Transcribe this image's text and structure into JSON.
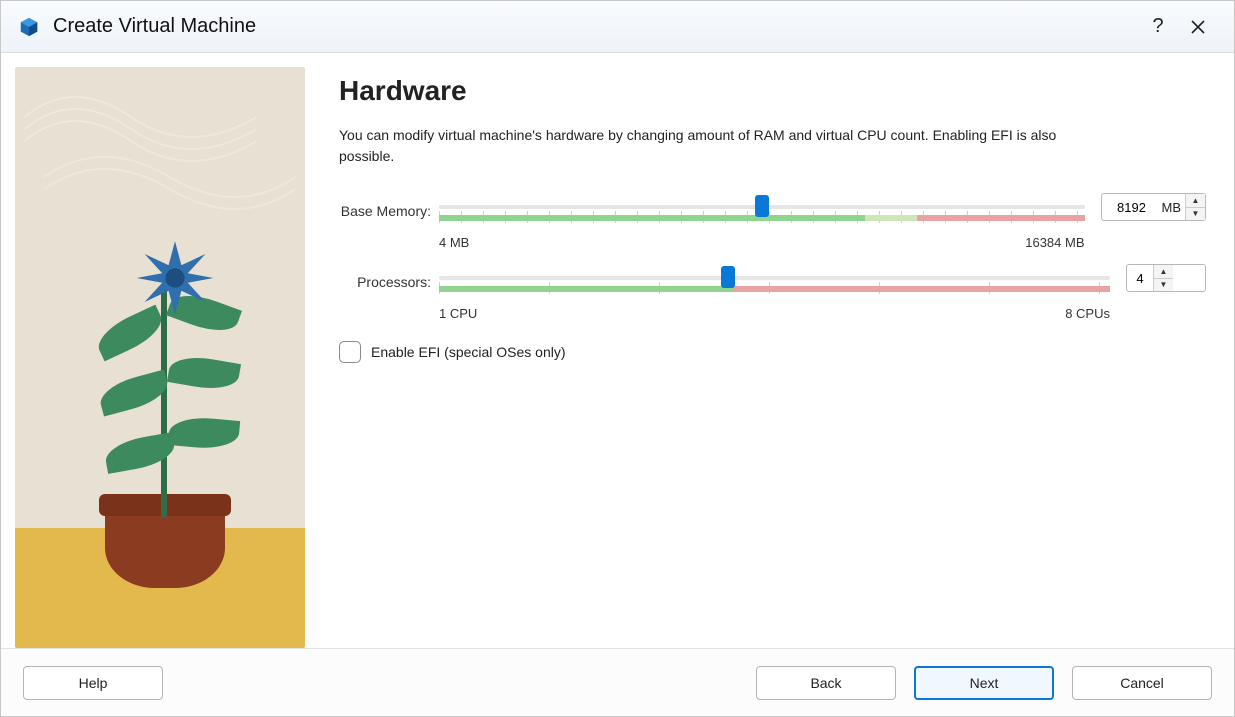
{
  "window": {
    "title": "Create Virtual Machine"
  },
  "page": {
    "heading": "Hardware",
    "description": "You can modify virtual machine's hardware by changing amount of RAM and virtual CPU count. Enabling EFI is also possible."
  },
  "memory": {
    "label": "Base Memory:",
    "min_label": "4 MB",
    "max_label": "16384 MB",
    "min": 4,
    "max": 16384,
    "value": 8192,
    "value_display": "8192",
    "unit": "MB",
    "thumb_percent": 50,
    "green_percent": 66,
    "fade_percent": 8,
    "red_percent": 26
  },
  "processors": {
    "label": "Processors:",
    "min_label": "1 CPU",
    "max_label": "8 CPUs",
    "min": 1,
    "max": 8,
    "value": 4,
    "thumb_percent": 43,
    "green_percent": 44,
    "red_percent": 56
  },
  "efi": {
    "label": "Enable EFI (special OSes only)",
    "checked": false
  },
  "buttons": {
    "help": "Help",
    "back": "Back",
    "next": "Next",
    "cancel": "Cancel"
  }
}
